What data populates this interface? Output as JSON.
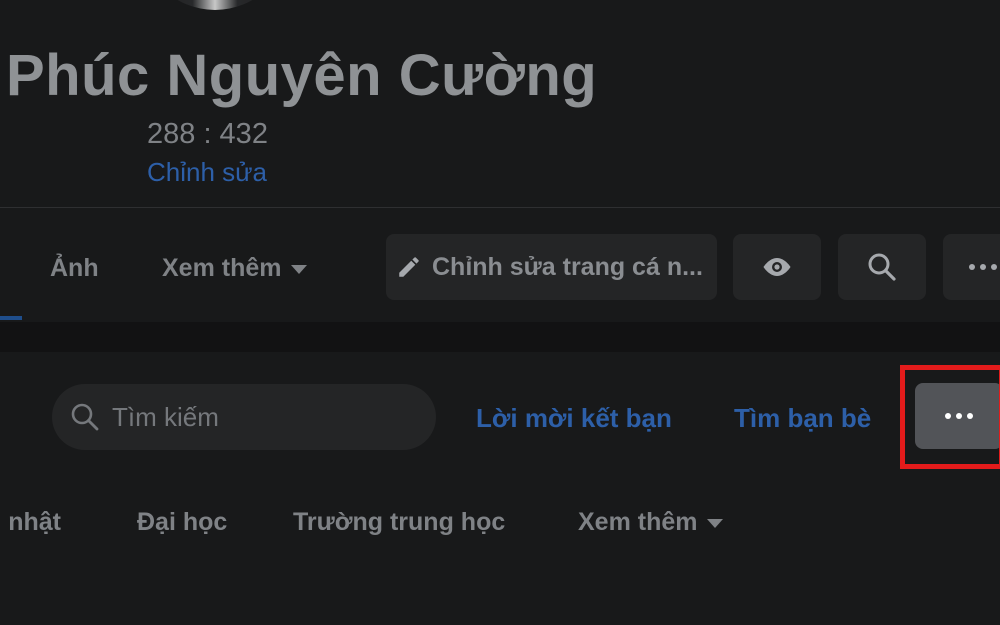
{
  "profile": {
    "name": "Phúc Nguyên Cường",
    "ratio": "288 : 432",
    "edit_link": "Chỉnh sửa"
  },
  "tabs": {
    "photos": "Ảnh",
    "more": "Xem thêm"
  },
  "actions": {
    "edit_profile": "Chỉnh sửa trang cá n...",
    "icons": [
      "pencil-icon",
      "eye-icon",
      "search-icon",
      "more-icon"
    ]
  },
  "friends": {
    "search_placeholder": "Tìm kiếm",
    "friend_requests": "Lời mời kết bạn",
    "find_friends": "Tìm bạn bè"
  },
  "filters": {
    "items": [
      "h nhật",
      "Đại học",
      "Trường trung học",
      "Xem thêm"
    ]
  },
  "colors": {
    "background": "#18191a",
    "link": "#2d5fa8",
    "highlight": "#e31b1b"
  }
}
